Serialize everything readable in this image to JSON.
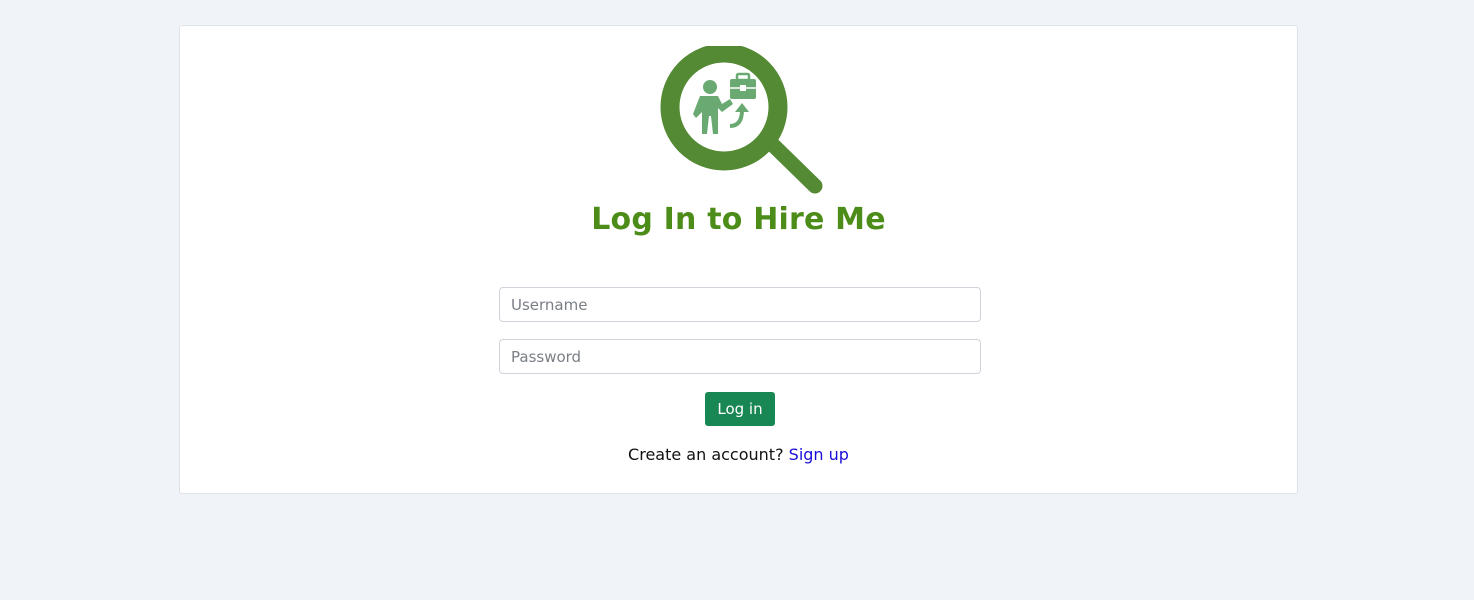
{
  "logo": {
    "icon": "magnifier-job-search-icon",
    "colors": {
      "ring": "#548a34",
      "figure": "#6aaa72"
    }
  },
  "title": "Log In to Hire Me",
  "form": {
    "username_placeholder": "Username",
    "password_placeholder": "Password",
    "login_label": "Log in"
  },
  "signup": {
    "prompt": "Create an account?",
    "link_label": "Sign up"
  },
  "colors": {
    "background": "#f0f3f8",
    "title": "#4c8c18",
    "button": "#198754",
    "link": "#1a0dd8"
  }
}
